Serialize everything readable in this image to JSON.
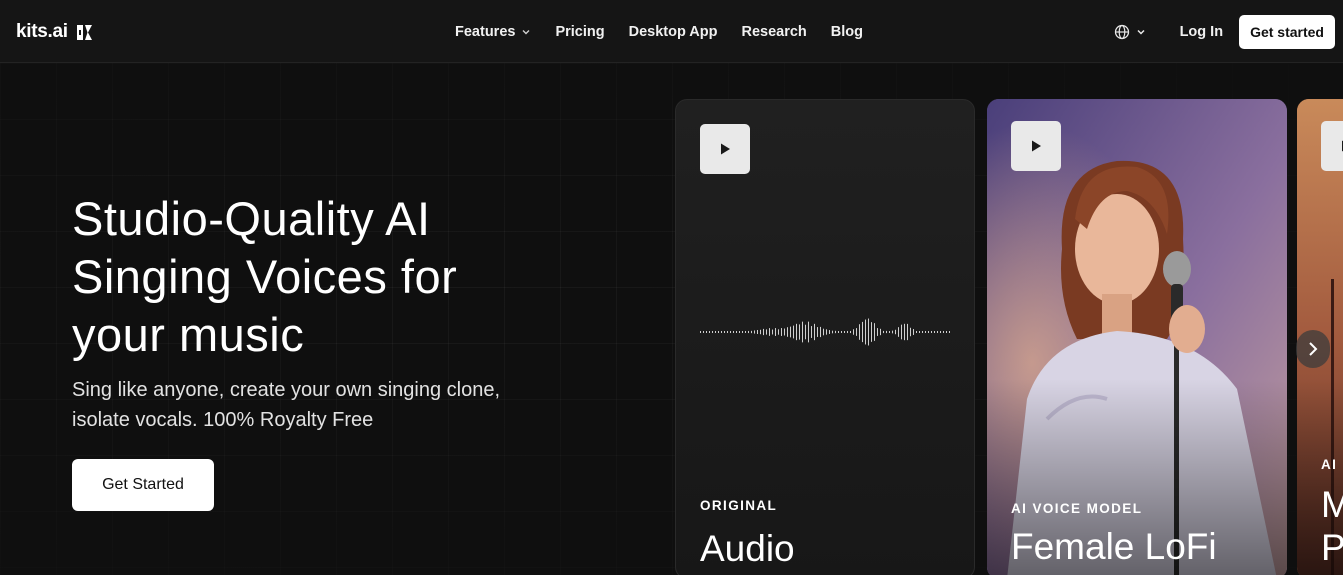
{
  "brand": {
    "name": "kits.ai"
  },
  "nav": {
    "links": [
      {
        "label": "Features"
      },
      {
        "label": "Pricing"
      },
      {
        "label": "Desktop App"
      },
      {
        "label": "Research"
      },
      {
        "label": "Blog"
      }
    ],
    "login_label": "Log In",
    "cta_label": "Get started"
  },
  "hero": {
    "title_lines": [
      "Studio-Quality AI",
      "Singing Voices for",
      "your music"
    ],
    "subtitle_lines": [
      "Sing like anyone, create your own singing clone,",
      "isolate vocals. 100% Royalty Free"
    ],
    "cta_label": "Get Started"
  },
  "cards": [
    {
      "kicker": "ORIGINAL",
      "title": "Audio"
    },
    {
      "kicker": "AI VOICE MODEL",
      "title": "Female LoFi"
    },
    {
      "kicker": "AI",
      "title": "M",
      "title2": "P"
    }
  ],
  "icons": {
    "globe": "globe-icon",
    "chevron": "chevron-down-icon",
    "play": "play-icon",
    "next": "chevron-right-icon"
  },
  "colors": {
    "background": "#0f0f0f",
    "nav_background": "#151515",
    "cta_background": "#ffffff",
    "cta_text": "#111111"
  }
}
